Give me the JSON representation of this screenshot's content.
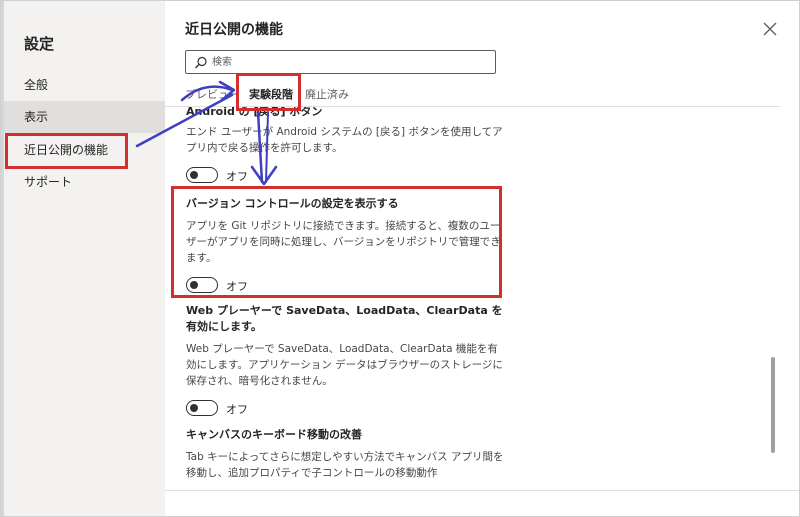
{
  "nav": {
    "title": "設定",
    "items": [
      {
        "label": "全般"
      },
      {
        "label": "表示"
      },
      {
        "label": "近日公開の機能"
      },
      {
        "label": "サポート"
      }
    ]
  },
  "main": {
    "title": "近日公開の機能",
    "search": {
      "placeholder": "検索",
      "value": ""
    },
    "tabs": [
      {
        "label": "プレビュー"
      },
      {
        "label": "実験段階"
      },
      {
        "label": "廃止済み"
      }
    ],
    "features": [
      {
        "title": "Android の [戻る] ボタン",
        "description": "エンド ユーザーが Android システムの [戻る] ボタンを使用してアプリ内で戻る操作を許可します。",
        "toggle": "オフ"
      },
      {
        "title": "バージョン コントロールの設定を表示する",
        "description": "アプリを Git リポジトリに接続できます。接続すると、複数のユーザーがアプリを同時に処理し、バージョンをリポジトリで管理できます。",
        "toggle": "オフ"
      },
      {
        "title": "Web プレーヤーで SaveData、LoadData、ClearData を有効にします。",
        "description": "Web プレーヤーで SaveData、LoadData、ClearData 機能を有効にします。アプリケーション データはブラウザーのストレージに保存され、暗号化されません。",
        "toggle": "オフ"
      },
      {
        "title": "キャンバスのキーボード移動の改善",
        "description": "Tab キーによってさらに想定しやすい方法でキャンバス アプリ間を移動し、追加プロパティで子コントロールの移動動作",
        "toggle": ""
      }
    ]
  },
  "colors": {
    "highlight": "#d32f2f",
    "arrow": "#3f3fbf",
    "nav_bg": "#f3f2f1",
    "nav_selected": "#e1dfdd"
  },
  "icons": {
    "search": "search-icon",
    "close": "close-icon"
  }
}
